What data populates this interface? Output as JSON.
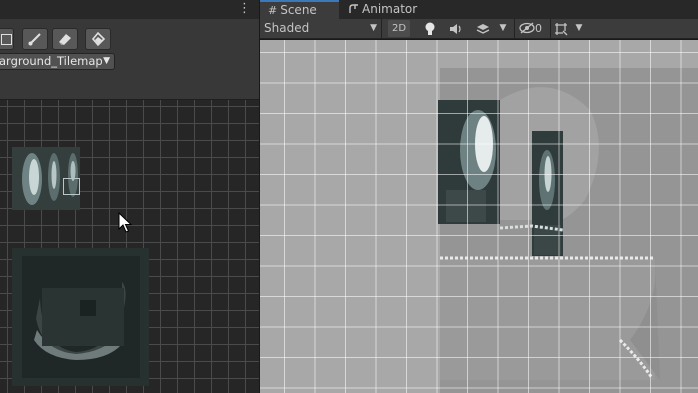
{
  "palette": {
    "menu_glyph": "⋮",
    "tools": [
      "select-tool",
      "paintbrush-tool",
      "eraser-tool",
      "fill-tool"
    ],
    "active_tilemap": "arground_Tilemap",
    "dropdown_arrow": "▼"
  },
  "scene": {
    "tabs": [
      {
        "icon": "grid-icon",
        "label": "Scene"
      },
      {
        "icon": "animator-icon",
        "label": "Animator"
      }
    ],
    "shading_mode": "Shaded",
    "mode_2d": "2D",
    "hidden_count": "0",
    "dropdown_arrow": "▼"
  },
  "colors": {
    "tab_accent": "#3a79bb",
    "scene_background": "#a8a8a8",
    "palette_background": "#262626"
  }
}
